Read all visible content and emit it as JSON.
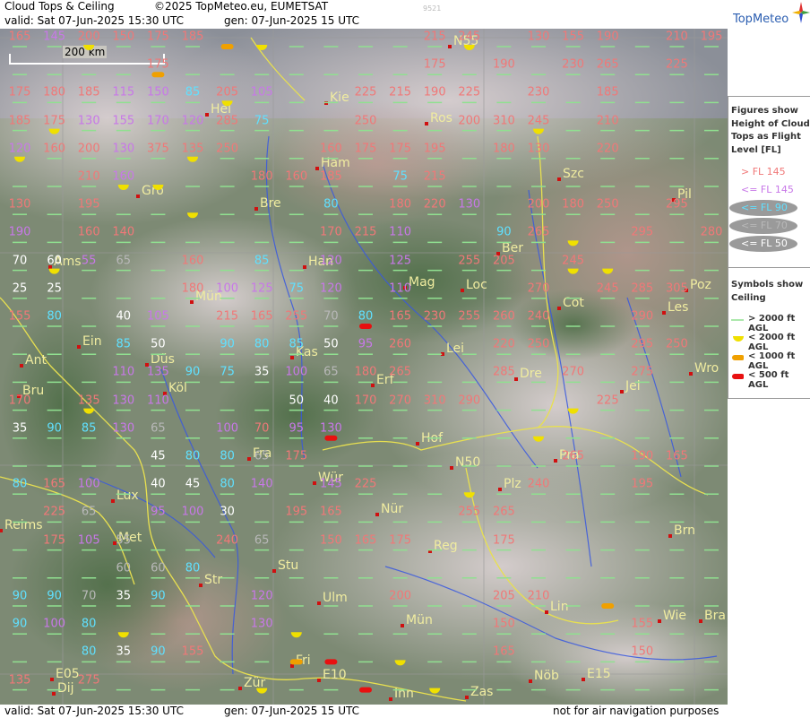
{
  "header": {
    "title": "Cloud Tops & Ceiling",
    "copyright": "©2025 TopMeteo.eu, EUMETSAT",
    "valid_line": "valid:  Sat  07-Jun-2025  15:30 UTC",
    "gen_line": "gen: 07-Jun-2025 15 UTC",
    "image_code": "9521",
    "logo_text": "TopMeteo"
  },
  "footer": {
    "valid_line": "valid:  Sat  07-Jun-2025  15:30 UTC",
    "gen_line": "gen: 07-Jun-2025 15 UTC",
    "disclaimer": "not for air navigation purposes"
  },
  "scale_bar": "200 km",
  "legend": {
    "tops_title": [
      "Figures show",
      "Height of Cloud",
      "Tops as Flight",
      "Level  [FL]"
    ],
    "tops_items": [
      {
        "label": "> FL 145",
        "color": "#f07878"
      },
      {
        "label": "<= FL 145",
        "color": "#c878e8"
      },
      {
        "label": "<= FL 90",
        "color": "#60e0ff"
      },
      {
        "label": "<= FL 70",
        "color": "#b8b8b8"
      },
      {
        "label": "<= FL 50",
        "color": "#ffffff"
      }
    ],
    "symbols_title": [
      "Symbols show",
      "Ceiling"
    ],
    "symbol_items": [
      {
        "label": "> 2000 ft AGL",
        "color": "#90e090",
        "shape": "line"
      },
      {
        "label": "< 2000 ft AGL",
        "color": "#f0e000",
        "shape": "half"
      },
      {
        "label": "< 1000 ft AGL",
        "color": "#f0a000",
        "shape": "bar"
      },
      {
        "label": "< 500 ft AGL",
        "color": "#e81010",
        "shape": "bar"
      }
    ]
  },
  "colors": {
    "above_145": "#f07878",
    "le_145": "#c878e8",
    "le_90": "#60e0ff",
    "le_70": "#b8b8b8",
    "le_50": "#ffffff",
    "city": "#f0eca0",
    "border": "#e8e050",
    "river": "#3858e0"
  },
  "cities": [
    {
      "name": "N55"
    },
    {
      "name": "Kie"
    },
    {
      "name": "Hel"
    },
    {
      "name": "Ros"
    },
    {
      "name": "Ham"
    },
    {
      "name": "Gro"
    },
    {
      "name": "Szc"
    },
    {
      "name": "Bre"
    },
    {
      "name": "Pil"
    },
    {
      "name": "Ber"
    },
    {
      "name": "Ams"
    },
    {
      "name": "Han"
    },
    {
      "name": "Mag"
    },
    {
      "name": "Loc"
    },
    {
      "name": "Poz"
    },
    {
      "name": "Mün"
    },
    {
      "name": "Cot"
    },
    {
      "name": "Les"
    },
    {
      "name": "Ein"
    },
    {
      "name": "Kas"
    },
    {
      "name": "Lei"
    },
    {
      "name": "Ant"
    },
    {
      "name": "Düs"
    },
    {
      "name": "Dre"
    },
    {
      "name": "Wro"
    },
    {
      "name": "Bru"
    },
    {
      "name": "Köl"
    },
    {
      "name": "Erf"
    },
    {
      "name": "Jel"
    },
    {
      "name": "Hof"
    },
    {
      "name": "Fra"
    },
    {
      "name": "N50"
    },
    {
      "name": "Pra"
    },
    {
      "name": "Wür"
    },
    {
      "name": "Plz"
    },
    {
      "name": "Lux"
    },
    {
      "name": "Nür"
    },
    {
      "name": "Reims"
    },
    {
      "name": "Met"
    },
    {
      "name": "Reg"
    },
    {
      "name": "Brn"
    },
    {
      "name": "Stu"
    },
    {
      "name": "Str"
    },
    {
      "name": "Ulm"
    },
    {
      "name": "Lin"
    },
    {
      "name": "Mün"
    },
    {
      "name": "Wie"
    },
    {
      "name": "Bra"
    },
    {
      "name": "Fri"
    },
    {
      "name": "E10"
    },
    {
      "name": "E05"
    },
    {
      "name": "Dij"
    },
    {
      "name": "Zür"
    },
    {
      "name": "Inn"
    },
    {
      "name": "Zas"
    },
    {
      "name": "Nöb"
    },
    {
      "name": "E15"
    }
  ],
  "grid_rows": [
    {
      "values": [
        "165",
        "145",
        "200",
        "150",
        "175",
        "185",
        "",
        "",
        "",
        "",
        "",
        "",
        "215",
        "245",
        "",
        "130",
        "155",
        "190",
        "",
        "210",
        "195",
        "205"
      ],
      "cats": [
        "r",
        "m",
        "r",
        "r",
        "r",
        "r",
        "",
        "",
        "",
        "",
        "",
        "",
        "r",
        "r",
        "",
        "r",
        "r",
        "r",
        "",
        "r",
        "r",
        "r"
      ]
    },
    {
      "values": [
        "",
        "",
        "",
        "",
        "175",
        "",
        "",
        "",
        "",
        "",
        "",
        "",
        "175",
        "",
        "190",
        "",
        "230",
        "265",
        "",
        "225",
        "",
        "225"
      ],
      "cats": [
        "",
        "",
        "",
        "",
        "r",
        "",
        "",
        "",
        "",
        "",
        "",
        "",
        "r",
        "",
        "r",
        "",
        "r",
        "r",
        "",
        "r",
        "",
        "r"
      ]
    },
    {
      "values": [
        "175",
        "180",
        "185",
        "115",
        "150",
        "85",
        "205",
        "105",
        "",
        "",
        "225",
        "215",
        "190",
        "225",
        "",
        "230",
        "",
        "185",
        "",
        "",
        "",
        "155"
      ],
      "cats": [
        "r",
        "r",
        "r",
        "m",
        "m",
        "c",
        "r",
        "m",
        "",
        "",
        "r",
        "r",
        "r",
        "r",
        "",
        "r",
        "",
        "r",
        "",
        "",
        "",
        "r"
      ]
    },
    {
      "values": [
        "185",
        "175",
        "130",
        "155",
        "170",
        "120",
        "285",
        "75",
        "",
        "",
        "250",
        "",
        "",
        "200",
        "310",
        "245",
        "",
        "210",
        "",
        "",
        "",
        "260"
      ],
      "cats": [
        "r",
        "r",
        "m",
        "m",
        "m",
        "m",
        "r",
        "c",
        "",
        "",
        "r",
        "",
        "",
        "r",
        "r",
        "r",
        "",
        "r",
        "",
        "",
        "",
        "r"
      ]
    },
    {
      "values": [
        "120",
        "160",
        "200",
        "130",
        "375",
        "135",
        "250",
        "",
        "",
        "160",
        "175",
        "175",
        "195",
        "",
        "180",
        "130",
        "",
        "220",
        "",
        "",
        "",
        "245"
      ],
      "cats": [
        "m",
        "r",
        "r",
        "m",
        "r",
        "r",
        "r",
        "",
        "",
        "r",
        "r",
        "r",
        "r",
        "",
        "r",
        "r",
        "",
        "r",
        "",
        "",
        "",
        "r"
      ]
    },
    {
      "values": [
        "",
        "",
        "210",
        "160",
        "",
        "",
        "",
        "180",
        "160",
        "185",
        "",
        "75",
        "215",
        "",
        "",
        "",
        "",
        "",
        "",
        "",
        "",
        "290"
      ],
      "cats": [
        "",
        "",
        "r",
        "m",
        "",
        "",
        "",
        "r",
        "r",
        "r",
        "",
        "c",
        "r",
        "",
        "",
        "",
        "",
        "",
        "",
        "",
        "",
        "r"
      ]
    },
    {
      "values": [
        "130",
        "",
        "195",
        "",
        "",
        "",
        "",
        "",
        "",
        "80",
        "",
        "180",
        "220",
        "130",
        "",
        "200",
        "180",
        "250",
        "",
        "295",
        "",
        ""
      ],
      "cats": [
        "r",
        "",
        "r",
        "",
        "",
        "",
        "",
        "",
        "",
        "c",
        "",
        "r",
        "r",
        "m",
        "",
        "r",
        "r",
        "r",
        "",
        "r",
        "",
        ""
      ]
    },
    {
      "values": [
        "190",
        "",
        "160",
        "140",
        "",
        "",
        "",
        "",
        "",
        "170",
        "215",
        "110",
        "",
        "",
        "90",
        "265",
        "",
        "",
        "295",
        "",
        "280",
        ""
      ],
      "cats": [
        "m",
        "",
        "r",
        "r",
        "",
        "",
        "",
        "",
        "",
        "r",
        "r",
        "m",
        "",
        "",
        "c",
        "r",
        "",
        "",
        "r",
        "",
        "r",
        ""
      ]
    },
    {
      "values": [
        "70",
        "60",
        "55",
        "65",
        "",
        "160",
        "",
        "85",
        "",
        "120",
        "",
        "125",
        "",
        "255",
        "205",
        "",
        "245",
        "",
        "",
        "",
        "",
        ""
      ],
      "cats": [
        "w",
        "w",
        "m",
        "g",
        "",
        "r",
        "",
        "c",
        "",
        "m",
        "",
        "m",
        "",
        "r",
        "r",
        "",
        "r",
        "",
        "",
        "",
        "",
        ""
      ]
    },
    {
      "values": [
        "25",
        "25",
        "",
        "",
        "",
        "180",
        "100",
        "125",
        "75",
        "120",
        "",
        "110",
        "",
        "",
        "",
        "270",
        "",
        "245",
        "285",
        "305",
        "",
        ""
      ],
      "cats": [
        "w",
        "w",
        "",
        "",
        "",
        "r",
        "m",
        "m",
        "c",
        "m",
        "",
        "m",
        "",
        "",
        "",
        "r",
        "",
        "r",
        "r",
        "r",
        "",
        ""
      ]
    },
    {
      "values": [
        "155",
        "80",
        "",
        "40",
        "105",
        "",
        "215",
        "165",
        "255",
        "70",
        "80",
        "165",
        "230",
        "255",
        "260",
        "240",
        "",
        "",
        "290",
        "",
        "",
        ""
      ],
      "cats": [
        "r",
        "c",
        "",
        "w",
        "m",
        "",
        "r",
        "r",
        "r",
        "g",
        "c",
        "r",
        "r",
        "r",
        "r",
        "r",
        "",
        "",
        "r",
        "",
        "",
        ""
      ]
    },
    {
      "values": [
        "",
        "",
        "",
        "85",
        "50",
        "",
        "90",
        "80",
        "85",
        "50",
        "95",
        "260",
        "",
        "",
        "220",
        "250",
        "",
        "",
        "295",
        "250",
        "",
        ""
      ],
      "cats": [
        "",
        "",
        "",
        "c",
        "w",
        "",
        "c",
        "c",
        "c",
        "w",
        "m",
        "r",
        "",
        "",
        "r",
        "r",
        "",
        "",
        "r",
        "r",
        "",
        ""
      ]
    },
    {
      "values": [
        "",
        "",
        "",
        "110",
        "135",
        "90",
        "75",
        "35",
        "100",
        "65",
        "180",
        "265",
        "",
        "",
        "285",
        "",
        "270",
        "",
        "275",
        "",
        "",
        ""
      ],
      "cats": [
        "",
        "",
        "",
        "m",
        "m",
        "c",
        "c",
        "w",
        "m",
        "g",
        "r",
        "r",
        "",
        "",
        "r",
        "",
        "r",
        "",
        "r",
        "",
        "",
        ""
      ]
    },
    {
      "values": [
        "170",
        "",
        "135",
        "130",
        "110",
        "",
        "",
        "",
        "50",
        "40",
        "170",
        "270",
        "310",
        "290",
        "",
        "",
        "",
        "225",
        "",
        "",
        "",
        ""
      ],
      "cats": [
        "r",
        "",
        "r",
        "m",
        "m",
        "",
        "",
        "",
        "w",
        "w",
        "r",
        "r",
        "r",
        "r",
        "",
        "",
        "",
        "r",
        "",
        "",
        "",
        ""
      ]
    },
    {
      "values": [
        "35",
        "90",
        "85",
        "130",
        "65",
        "",
        "100",
        "70",
        "95",
        "130",
        "",
        "",
        "",
        "",
        "",
        "",
        "",
        "",
        "",
        "",
        "",
        ""
      ],
      "cats": [
        "w",
        "c",
        "c",
        "m",
        "g",
        "",
        "m",
        "r",
        "m",
        "m",
        "",
        "",
        "",
        "",
        "",
        "",
        "",
        "",
        "",
        "",
        "",
        ""
      ]
    },
    {
      "values": [
        "",
        "",
        "",
        "",
        "45",
        "80",
        "80",
        "65",
        "175",
        "",
        "",
        "",
        "",
        "",
        "",
        "",
        "265",
        "",
        "190",
        "165",
        "",
        ""
      ],
      "cats": [
        "",
        "",
        "",
        "",
        "w",
        "c",
        "c",
        "g",
        "r",
        "",
        "",
        "",
        "",
        "",
        "",
        "",
        "r",
        "",
        "r",
        "r",
        "",
        ""
      ]
    },
    {
      "values": [
        "80",
        "165",
        "100",
        "",
        "40",
        "45",
        "80",
        "140",
        "",
        "145",
        "225",
        "",
        "",
        "",
        "",
        "240",
        "",
        "",
        "195",
        "",
        "",
        ""
      ],
      "cats": [
        "c",
        "r",
        "m",
        "",
        "w",
        "w",
        "c",
        "m",
        "",
        "m",
        "r",
        "",
        "",
        "",
        "",
        "r",
        "",
        "",
        "r",
        "",
        "",
        ""
      ]
    },
    {
      "values": [
        "",
        "225",
        "65",
        "",
        "95",
        "100",
        "30",
        "",
        "195",
        "165",
        "",
        "",
        "",
        "255",
        "265",
        "",
        "",
        "",
        "",
        "",
        "",
        ""
      ],
      "cats": [
        "",
        "r",
        "g",
        "",
        "m",
        "m",
        "w",
        "",
        "r",
        "r",
        "",
        "",
        "",
        "r",
        "r",
        "",
        "",
        "",
        "",
        "",
        "",
        ""
      ]
    },
    {
      "values": [
        "",
        "175",
        "105",
        "55",
        "",
        "",
        "240",
        "65",
        "",
        "150",
        "165",
        "175",
        "",
        "",
        "175",
        "",
        "",
        "",
        "",
        "",
        "",
        ""
      ],
      "cats": [
        "",
        "r",
        "m",
        "g",
        "",
        "",
        "r",
        "g",
        "",
        "r",
        "r",
        "r",
        "",
        "",
        "r",
        "",
        "",
        "",
        "",
        "",
        "",
        ""
      ]
    },
    {
      "values": [
        "",
        "",
        "",
        "60",
        "60",
        "80",
        "",
        "",
        "",
        "",
        "",
        "",
        "",
        "",
        "",
        "",
        "",
        "",
        "",
        "",
        "",
        ""
      ],
      "cats": [
        "",
        "",
        "",
        "g",
        "g",
        "c",
        "",
        "",
        "",
        "",
        "",
        "",
        "",
        "",
        "",
        "",
        "",
        "",
        "",
        "",
        "",
        ""
      ]
    },
    {
      "values": [
        "90",
        "90",
        "70",
        "35",
        "90",
        "",
        "",
        "120",
        "",
        "",
        "",
        "200",
        "",
        "",
        "205",
        "210",
        "",
        "",
        "",
        "",
        "",
        ""
      ],
      "cats": [
        "c",
        "c",
        "g",
        "w",
        "c",
        "",
        "",
        "m",
        "",
        "",
        "",
        "r",
        "",
        "",
        "r",
        "r",
        "",
        "",
        "",
        "",
        "",
        ""
      ]
    },
    {
      "values": [
        "90",
        "100",
        "80",
        "",
        "",
        "",
        "",
        "130",
        "",
        "",
        "",
        "",
        "",
        "",
        "150",
        "",
        "",
        "",
        "155",
        "",
        "",
        ""
      ],
      "cats": [
        "c",
        "m",
        "c",
        "",
        "",
        "",
        "",
        "m",
        "",
        "",
        "",
        "",
        "",
        "",
        "r",
        "",
        "",
        "",
        "r",
        "",
        "",
        ""
      ]
    },
    {
      "values": [
        "",
        "",
        "80",
        "35",
        "90",
        "155",
        "",
        "",
        "",
        "",
        "",
        "",
        "",
        "",
        "165",
        "",
        "",
        "",
        "150",
        "",
        "",
        ""
      ],
      "cats": [
        "",
        "",
        "c",
        "w",
        "c",
        "r",
        "",
        "",
        "",
        "",
        "",
        "",
        "",
        "",
        "r",
        "",
        "",
        "",
        "r",
        "",
        "",
        ""
      ]
    },
    {
      "values": [
        "135",
        "",
        "275",
        "",
        "",
        "",
        "",
        "",
        "",
        "",
        "",
        "",
        "",
        "",
        "",
        "",
        "",
        "",
        "",
        "",
        "",
        ""
      ],
      "cats": [
        "r",
        "",
        "r",
        "",
        "",
        "",
        "",
        "",
        "",
        "",
        "",
        "",
        "",
        "",
        "",
        "",
        "",
        "",
        "",
        "",
        "",
        ""
      ]
    }
  ]
}
